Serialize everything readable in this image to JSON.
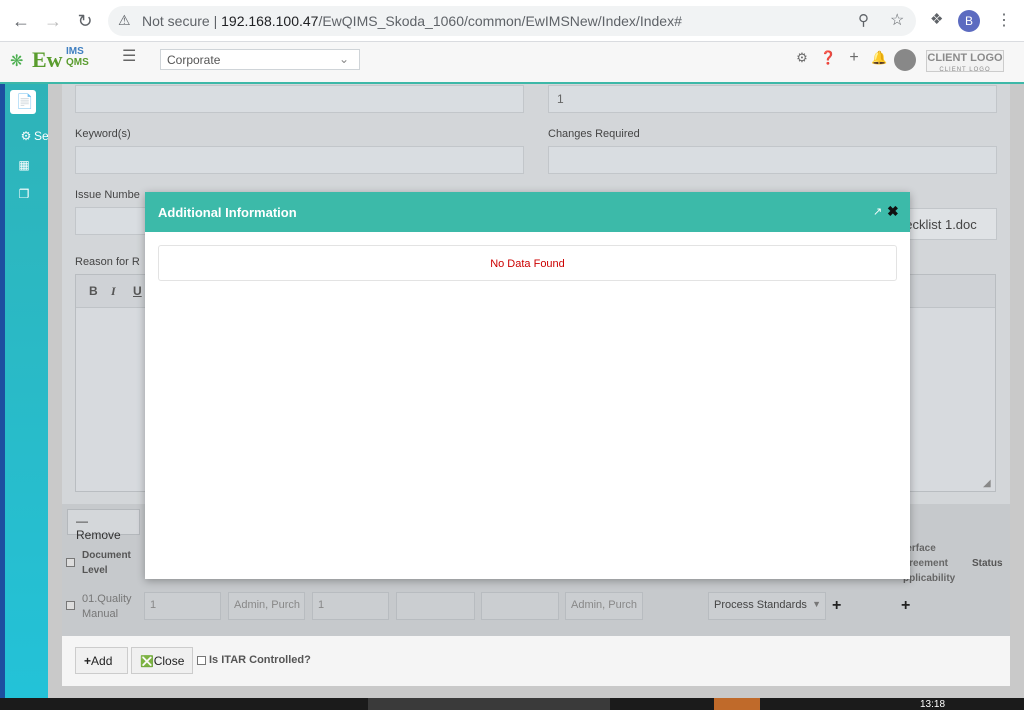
{
  "browser": {
    "security_label": "Not secure",
    "url_host": "192.168.100.47",
    "url_path": "/EwQIMS_Skoda_1060/common/EwIMSNew/Index/Index#",
    "profile_initial": "B"
  },
  "app": {
    "logo_text": "Ew",
    "logo_sup": "IMS",
    "logo_sub": "QMS",
    "org_select_value": "Corporate",
    "client_logo": "CLIENT LOGO",
    "client_logo_sub": "CLIENT LOGO",
    "sidebar_truncated_label": "Se"
  },
  "form": {
    "field_top_right_value": "1",
    "keywords_label": "Keyword(s)",
    "changes_required_label": "Changes Required",
    "issue_number_label": "Issue Numbe",
    "attachment_value": "hecklist 1.doc",
    "reason_label": "Reason for R",
    "toolbar": {
      "bold": "B",
      "italic": "I",
      "underline": "U"
    }
  },
  "table": {
    "remove_label": "Remove",
    "headers": {
      "document_level": "Document Level",
      "interface_agreement": "terface greement pplicability",
      "status": "Status"
    },
    "row": {
      "document_level": "01.Quality Manual",
      "c1": "1",
      "c2": "Admin, Purch",
      "c3": "1",
      "c4": "",
      "c5": "",
      "c6": "Admin, Purch",
      "process_standards": "Process Standards"
    }
  },
  "footer": {
    "add_label": "Add",
    "close_label": "Close",
    "itar_label": "Is ITAR Controlled?"
  },
  "modal": {
    "title": "Additional Information",
    "no_data": "No Data Found"
  },
  "taskbar": {
    "clock": "13:18"
  }
}
